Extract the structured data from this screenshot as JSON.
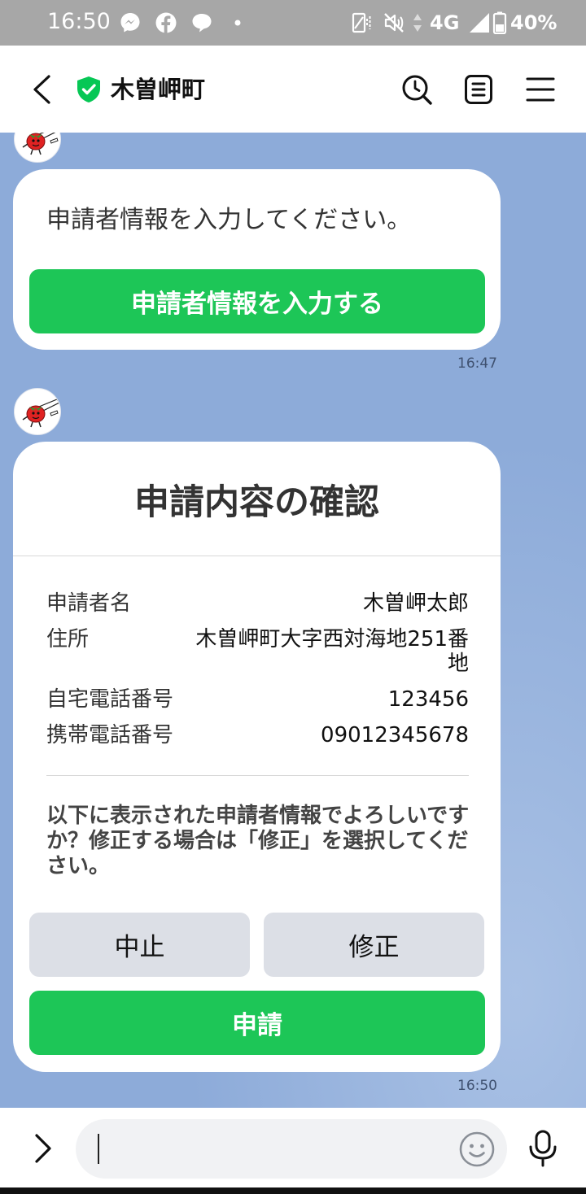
{
  "status_bar": {
    "time": "16:50",
    "network": "4G",
    "battery": "40%",
    "left_icons": [
      "messenger-icon",
      "facebook-icon",
      "chat-bubble-icon",
      "dot-icon"
    ],
    "right_icons": [
      "nfc-icon",
      "mute-icon",
      "data-arrows-icon",
      "signal-icon",
      "battery-icon"
    ]
  },
  "header": {
    "title": "木曽岬町",
    "icons": [
      "back-icon",
      "verified-shield-icon",
      "history-search-icon",
      "notes-icon",
      "menu-icon"
    ]
  },
  "messages": [
    {
      "text": "申請者情報を入力してください。",
      "button_label": "申請者情報を入力する",
      "time": "16:47"
    },
    {
      "title": "申請内容の確認",
      "rows": [
        {
          "label": "申請者名",
          "value": "木曽岬太郎"
        },
        {
          "label": "住所",
          "value": "木曽岬町大字西対海地251番地"
        },
        {
          "label": "自宅電話番号",
          "value": "123456"
        },
        {
          "label": "携帯電話番号",
          "value": "09012345678"
        }
      ],
      "prompt": "以下に表示された申請者情報でよろしいですか？修正する場合は「修正」を選択してください。",
      "cancel_label": "中止",
      "edit_label": "修正",
      "submit_label": "申請",
      "time": "16:50"
    }
  ],
  "composer": {
    "icons": [
      "expand-icon",
      "emoji-icon",
      "microphone-icon"
    ]
  },
  "colors": {
    "accent_green": "#1dc657",
    "chat_background": "#8dabd9",
    "secondary_button": "#dcdfe6",
    "status_bar": "#a7a7a7"
  }
}
